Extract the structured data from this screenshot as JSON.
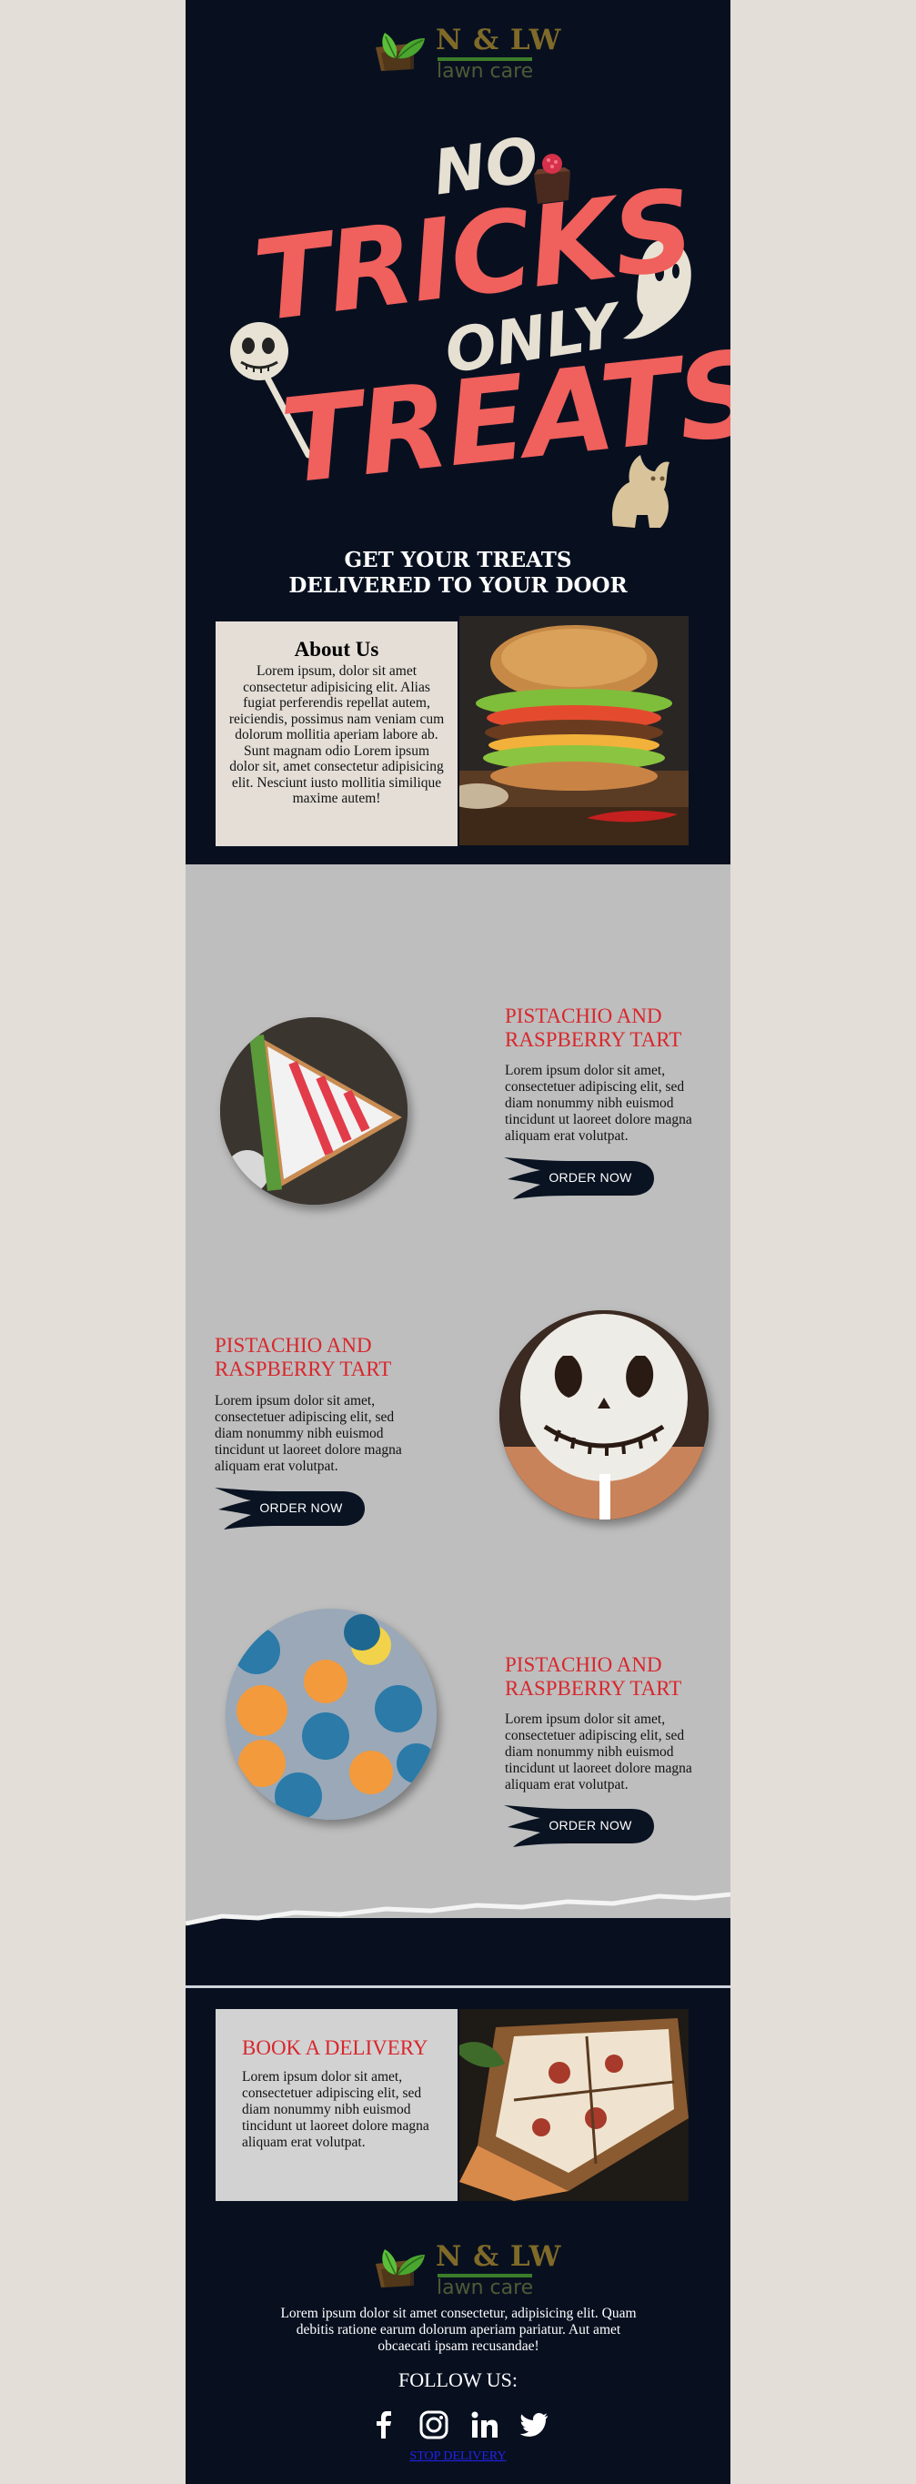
{
  "brand": {
    "name": "N & LW",
    "tagline": "lawn care",
    "colors": {
      "brand_gold": "#7f6a28",
      "brand_green": "#3c7d2a",
      "leaf_green": "#5bbf3a"
    }
  },
  "hero": {
    "word1": "NO",
    "word2": "TRICKS",
    "word3": "ONLY",
    "word4": "TREATS",
    "headline": "GET YOUR TREATS DELIVERED TO YOUR DOOR",
    "colors": {
      "red": "#f0605c",
      "cream": "#e6e0d2"
    }
  },
  "about": {
    "title": "About Us",
    "body": "Lorem ipsum, dolor sit amet consectetur adipisicing elit. Alias fugiat perferendis repellat autem, reiciendis, possimus nam veniam cum dolorum mollitia aperiam labore ab. Sunt magnam odio Lorem ipsum dolor sit, amet consectetur adipisicing elit. Nesciunt iusto mollitia similique maxime autem!",
    "image": "burger-photo"
  },
  "products": [
    {
      "title": "PISTACHIO AND RASPBERRY TART",
      "body": "Lorem ipsum dolor sit amet, consectetuer adipiscing elit, sed diam nonummy nibh euismod tincidunt ut laoreet dolore magna aliquam erat volutpat.",
      "button": "ORDER NOW",
      "image": "tart-slice-photo"
    },
    {
      "title": "PISTACHIO AND RASPBERRY TART",
      "body": "Lorem ipsum dolor sit amet, consectetuer adipiscing elit, sed diam nonummy nibh euismod tincidunt ut laoreet dolore magna aliquam erat volutpat.",
      "button": "ORDER NOW",
      "image": "skull-cakepop-photo"
    },
    {
      "title": "PISTACHIO AND RASPBERRY TART",
      "body": "Lorem ipsum dolor sit amet, consectetuer adipiscing elit, sed diam nonummy nibh euismod tincidunt ut laoreet dolore magna aliquam erat volutpat.",
      "button": "ORDER NOW",
      "image": "macarons-photo"
    }
  ],
  "book": {
    "title": "BOOK A DELIVERY",
    "body": "Lorem ipsum dolor sit amet, consectetuer adipiscing elit, sed diam nonummy nibh euismod tincidunt ut laoreet dolore magna aliquam erat volutpat.",
    "image": "pizza-photo"
  },
  "footer": {
    "text": "Lorem ipsum dolor sit amet consectetur, adipisicing elit. Quam debitis ratione earum dolorum aperiam pariatur. Aut amet obcaecati ipsam recusandae!",
    "follow": "FOLLOW US:",
    "social": [
      "facebook-icon",
      "instagram-icon",
      "linkedin-icon",
      "twitter-icon"
    ],
    "unsubscribe": "STOP DELIVERY"
  },
  "colors": {
    "navy": "#081020",
    "grey_section": "#bebebe",
    "about_box": "#e4ded7",
    "accent_red": "#d8272d",
    "page_bg": "#e3ded8"
  }
}
